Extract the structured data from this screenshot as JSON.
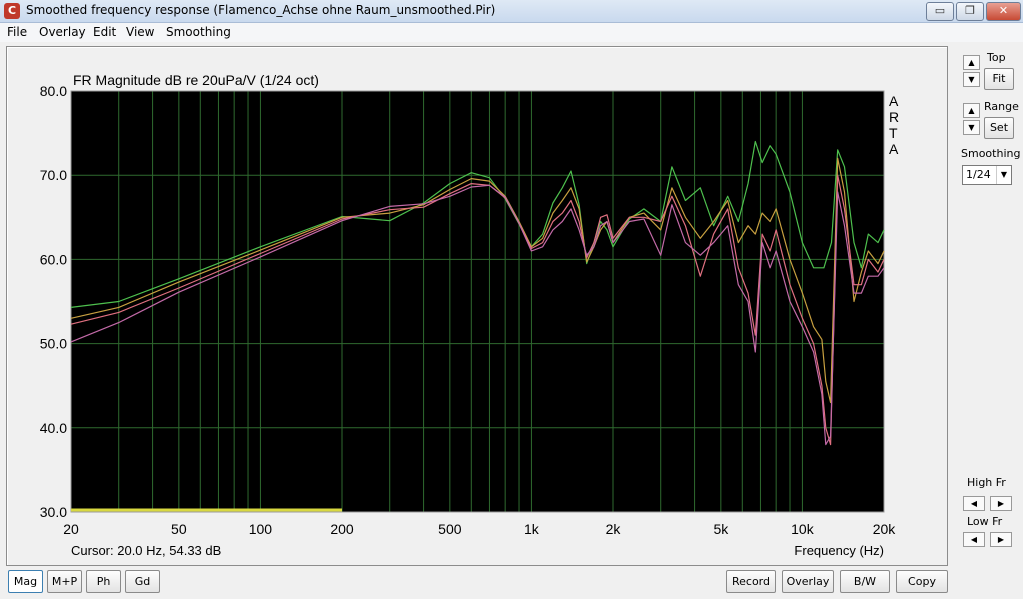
{
  "window": {
    "title": "Smoothed frequency response (Flamenco_Achse ohne Raum_unsmoothed.Pir)",
    "app_icon": "C",
    "minimize": "▭",
    "maximize": "❐",
    "close": "✕"
  },
  "menu": [
    "File",
    "Overlay",
    "Edit",
    "View",
    "Smoothing"
  ],
  "chart": {
    "title": "FR Magnitude dB re 20uPa/V (1/24 oct)",
    "watermark": [
      "A",
      "R",
      "T",
      "A"
    ],
    "cursor_text": "Cursor: 20.0 Hz, 54.33 dB",
    "xlabel": "Frequency (Hz)"
  },
  "chart_data": {
    "type": "line",
    "title": "FR Magnitude dB re 20uPa/V (1/24 oct)",
    "xlabel": "Frequency (Hz)",
    "ylabel": "",
    "x_scale": "log",
    "xlim": [
      20,
      20000
    ],
    "ylim": [
      30,
      80
    ],
    "grid": true,
    "x_ticks": [
      {
        "v": 20,
        "l": "20"
      },
      {
        "v": 50,
        "l": "50"
      },
      {
        "v": 100,
        "l": "100"
      },
      {
        "v": 200,
        "l": "200"
      },
      {
        "v": 500,
        "l": "500"
      },
      {
        "v": 1000,
        "l": "1k"
      },
      {
        "v": 2000,
        "l": "2k"
      },
      {
        "v": 5000,
        "l": "5k"
      },
      {
        "v": 10000,
        "l": "10k"
      },
      {
        "v": 20000,
        "l": "20k"
      }
    ],
    "y_ticks": [
      {
        "v": 30,
        "l": "30.0"
      },
      {
        "v": 40,
        "l": "40.0"
      },
      {
        "v": 50,
        "l": "50.0"
      },
      {
        "v": 60,
        "l": "60.0"
      },
      {
        "v": 70,
        "l": "70.0"
      },
      {
        "v": 80,
        "l": "80.0"
      }
    ],
    "colors": {
      "background": "#000000",
      "grid": "#2f6a2f",
      "axis": "#9a9a9a"
    },
    "series": [
      {
        "color": "#4ec04e",
        "points": [
          [
            20,
            54.3
          ],
          [
            30,
            55
          ],
          [
            50,
            57.7
          ],
          [
            100,
            61.5
          ],
          [
            200,
            65.1
          ],
          [
            300,
            64.6
          ],
          [
            400,
            66.7
          ],
          [
            500,
            69
          ],
          [
            600,
            70.3
          ],
          [
            700,
            69.7
          ],
          [
            800,
            67.2
          ],
          [
            900,
            64.2
          ],
          [
            1000,
            61.5
          ],
          [
            1100,
            63
          ],
          [
            1200,
            66.7
          ],
          [
            1300,
            68.5
          ],
          [
            1400,
            70.5
          ],
          [
            1500,
            66.5
          ],
          [
            1600,
            59.5
          ],
          [
            1700,
            62
          ],
          [
            1800,
            64.5
          ],
          [
            1900,
            63.5
          ],
          [
            2000,
            61.5
          ],
          [
            2300,
            64.8
          ],
          [
            2600,
            66
          ],
          [
            3000,
            64.5
          ],
          [
            3300,
            71
          ],
          [
            3700,
            67
          ],
          [
            4200,
            68.5
          ],
          [
            4700,
            64
          ],
          [
            5300,
            67.5
          ],
          [
            5800,
            64.5
          ],
          [
            6300,
            69
          ],
          [
            6700,
            74
          ],
          [
            7100,
            71.5
          ],
          [
            7600,
            73.5
          ],
          [
            8000,
            72.5
          ],
          [
            9000,
            68
          ],
          [
            10000,
            62
          ],
          [
            11000,
            59
          ],
          [
            12000,
            59
          ],
          [
            12800,
            62
          ],
          [
            13500,
            73
          ],
          [
            14300,
            71
          ],
          [
            15500,
            62
          ],
          [
            16500,
            59
          ],
          [
            17500,
            63
          ],
          [
            19000,
            62
          ],
          [
            20000,
            63.5
          ]
        ]
      },
      {
        "color": "#c8a040",
        "points": [
          [
            20,
            53
          ],
          [
            30,
            54.3
          ],
          [
            50,
            57.3
          ],
          [
            100,
            61.1
          ],
          [
            200,
            65
          ],
          [
            300,
            65.5
          ],
          [
            400,
            66.5
          ],
          [
            500,
            68.3
          ],
          [
            600,
            69.6
          ],
          [
            700,
            69.3
          ],
          [
            800,
            67.5
          ],
          [
            900,
            64.5
          ],
          [
            1000,
            61.5
          ],
          [
            1100,
            62.5
          ],
          [
            1200,
            65.5
          ],
          [
            1300,
            67
          ],
          [
            1400,
            68.5
          ],
          [
            1500,
            66
          ],
          [
            1600,
            59.7
          ],
          [
            1700,
            61.5
          ],
          [
            1800,
            63.5
          ],
          [
            1900,
            64.5
          ],
          [
            2000,
            62
          ],
          [
            2300,
            65
          ],
          [
            2600,
            65.5
          ],
          [
            3000,
            63.5
          ],
          [
            3300,
            68.5
          ],
          [
            3700,
            65
          ],
          [
            4200,
            62.5
          ],
          [
            4700,
            64.5
          ],
          [
            5300,
            67
          ],
          [
            5800,
            62
          ],
          [
            6300,
            64
          ],
          [
            6700,
            63
          ],
          [
            7100,
            65.5
          ],
          [
            7600,
            64.5
          ],
          [
            8000,
            66
          ],
          [
            9000,
            60
          ],
          [
            10000,
            56
          ],
          [
            11000,
            52
          ],
          [
            11800,
            50.5
          ],
          [
            12200,
            45.5
          ],
          [
            12700,
            43
          ],
          [
            13500,
            72
          ],
          [
            14300,
            68
          ],
          [
            15500,
            55
          ],
          [
            16500,
            58.5
          ],
          [
            17500,
            61
          ],
          [
            19000,
            59.5
          ],
          [
            20000,
            61
          ]
        ]
      },
      {
        "color": "#e07080",
        "points": [
          [
            20,
            52.3
          ],
          [
            30,
            53.7
          ],
          [
            50,
            56.6
          ],
          [
            100,
            60.7
          ],
          [
            200,
            64.8
          ],
          [
            300,
            65.9
          ],
          [
            400,
            66.2
          ],
          [
            500,
            67.8
          ],
          [
            600,
            69
          ],
          [
            700,
            68.8
          ],
          [
            800,
            67.3
          ],
          [
            900,
            64.3
          ],
          [
            1000,
            61.3
          ],
          [
            1100,
            62
          ],
          [
            1200,
            64.5
          ],
          [
            1300,
            65.5
          ],
          [
            1400,
            67
          ],
          [
            1500,
            64.5
          ],
          [
            1600,
            60.2
          ],
          [
            1700,
            62
          ],
          [
            1800,
            65
          ],
          [
            1900,
            65.3
          ],
          [
            2000,
            62.5
          ],
          [
            2300,
            65
          ],
          [
            2600,
            65
          ],
          [
            3000,
            64.5
          ],
          [
            3300,
            67.5
          ],
          [
            3700,
            64
          ],
          [
            4200,
            58
          ],
          [
            4700,
            63
          ],
          [
            5300,
            66
          ],
          [
            5800,
            59
          ],
          [
            6300,
            56
          ],
          [
            6700,
            51
          ],
          [
            7100,
            63
          ],
          [
            7600,
            61
          ],
          [
            8000,
            63.5
          ],
          [
            9000,
            57
          ],
          [
            10000,
            53
          ],
          [
            11000,
            50
          ],
          [
            11800,
            45
          ],
          [
            12200,
            40
          ],
          [
            12700,
            38
          ],
          [
            13500,
            70
          ],
          [
            14300,
            66
          ],
          [
            15500,
            57
          ],
          [
            16500,
            57
          ],
          [
            17500,
            60
          ],
          [
            19000,
            58.5
          ],
          [
            20000,
            60
          ]
        ]
      },
      {
        "color": "#c36aa8",
        "points": [
          [
            20,
            50.2
          ],
          [
            30,
            52.5
          ],
          [
            50,
            56.1
          ],
          [
            100,
            60.3
          ],
          [
            200,
            64.6
          ],
          [
            300,
            66.3
          ],
          [
            400,
            66.6
          ],
          [
            500,
            67.5
          ],
          [
            600,
            68.6
          ],
          [
            700,
            68.8
          ],
          [
            800,
            67.4
          ],
          [
            900,
            64.3
          ],
          [
            1000,
            61
          ],
          [
            1100,
            61.5
          ],
          [
            1200,
            63.5
          ],
          [
            1300,
            64.5
          ],
          [
            1400,
            66
          ],
          [
            1500,
            63.5
          ],
          [
            1600,
            60.5
          ],
          [
            1700,
            61.5
          ],
          [
            1800,
            64
          ],
          [
            1900,
            64.5
          ],
          [
            2000,
            62
          ],
          [
            2300,
            64.5
          ],
          [
            2600,
            64.8
          ],
          [
            3000,
            60.5
          ],
          [
            3300,
            66.5
          ],
          [
            3700,
            62
          ],
          [
            4200,
            60.5
          ],
          [
            4700,
            62
          ],
          [
            5300,
            64
          ],
          [
            5800,
            57
          ],
          [
            6300,
            55
          ],
          [
            6700,
            49
          ],
          [
            7100,
            62
          ],
          [
            7600,
            59
          ],
          [
            8000,
            61
          ],
          [
            9000,
            55
          ],
          [
            10000,
            52
          ],
          [
            11000,
            49
          ],
          [
            11800,
            44
          ],
          [
            12200,
            38
          ],
          [
            12700,
            39
          ],
          [
            13500,
            68
          ],
          [
            14300,
            64
          ],
          [
            15500,
            56
          ],
          [
            16500,
            56
          ],
          [
            17500,
            58
          ],
          [
            19000,
            58
          ],
          [
            20000,
            59
          ]
        ]
      }
    ],
    "cursor_range": [
      20,
      200
    ],
    "cursor_color": "#d8d840"
  },
  "side": {
    "top_label": "Top",
    "fit_label": "Fit",
    "range_label": "Range",
    "set_label": "Set",
    "smoothing_label": "Smoothing",
    "smoothing_value": "1/24",
    "high_fr_label": "High Fr",
    "low_fr_label": "Low Fr",
    "up": "▲",
    "down": "▼",
    "left": "◀",
    "right": "▶"
  },
  "bottom": {
    "left_buttons": [
      "Mag",
      "M+P",
      "Ph",
      "Gd"
    ],
    "right_buttons": [
      "Record",
      "Overlay",
      "B/W",
      "Copy"
    ]
  }
}
